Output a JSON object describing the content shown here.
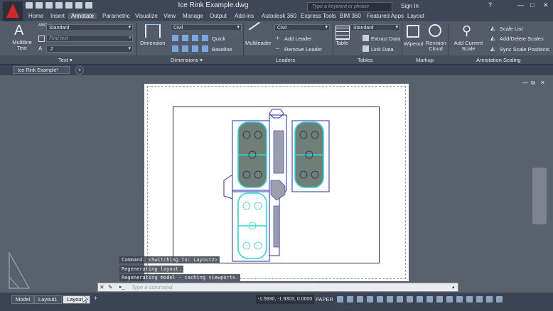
{
  "title": "Ice Rink Example.dwg",
  "search_placeholder": "Type a keyword or phrase",
  "sign_in": "Sign In",
  "help": "?",
  "window_controls": {
    "min": "—",
    "max": "□",
    "close": "✕"
  },
  "ribbon_tabs": [
    "Home",
    "Insert",
    "Annotate",
    "Parametric",
    "Visualize",
    "View",
    "Manage",
    "Output",
    "Add-ins",
    "Autodesk 360",
    "Express Tools",
    "BIM 360",
    "Featured Apps",
    "Layout"
  ],
  "active_tab": "Annotate",
  "text_panel": {
    "multiline_text": "Multiline Text",
    "style": "Standard",
    "find_placeholder": "Find text",
    "height": ".2",
    "panel_label": "Text ▾"
  },
  "dimensions_panel": {
    "dimension": "Dimension",
    "style": "Civil",
    "quick": "Quick",
    "baseline": "Baseline",
    "panel_label": "Dimensions ▾"
  },
  "leaders_panel": {
    "multileader": "Multileader",
    "style": "Civil",
    "add_leader": "Add Leader",
    "remove_leader": "Remove Leader",
    "panel_label": "Leaders"
  },
  "tables_panel": {
    "table": "Table",
    "style": "Standard",
    "extract_data": "Extract Data",
    "link_data": "Link Data",
    "panel_label": "Tables"
  },
  "markup_panel": {
    "wipeout": "Wipeout",
    "revision_cloud": "Revision Cloud",
    "panel_label": "Markup"
  },
  "annotation_scaling_panel": {
    "add_current_scale": "Add Current Scale",
    "scale_list": "Scale List",
    "add_delete_scales": "Add/Delete Scales",
    "sync_scale_positions": "Sync Scale Positions",
    "panel_label": "Annotation Scaling"
  },
  "document_tab": "Ice Rink Example*",
  "command_history": [
    "Command:  <Switching to: Layout2>",
    "Regenerating layout.",
    "Regenerating model - caching viewports."
  ],
  "command_placeholder": "Type a command",
  "layout_tabs": [
    "Model",
    "Layout1",
    "Layout2"
  ],
  "active_layout": "Layout2",
  "coordinates": "-1.5930, -1.9303, 0.0000",
  "space": "PAPER",
  "colors": {
    "accent_red": "#d9262c",
    "rink_cyan": "#2ad8d8",
    "drawing_blue": "#2a2ab0",
    "workspace": "#59616d"
  }
}
